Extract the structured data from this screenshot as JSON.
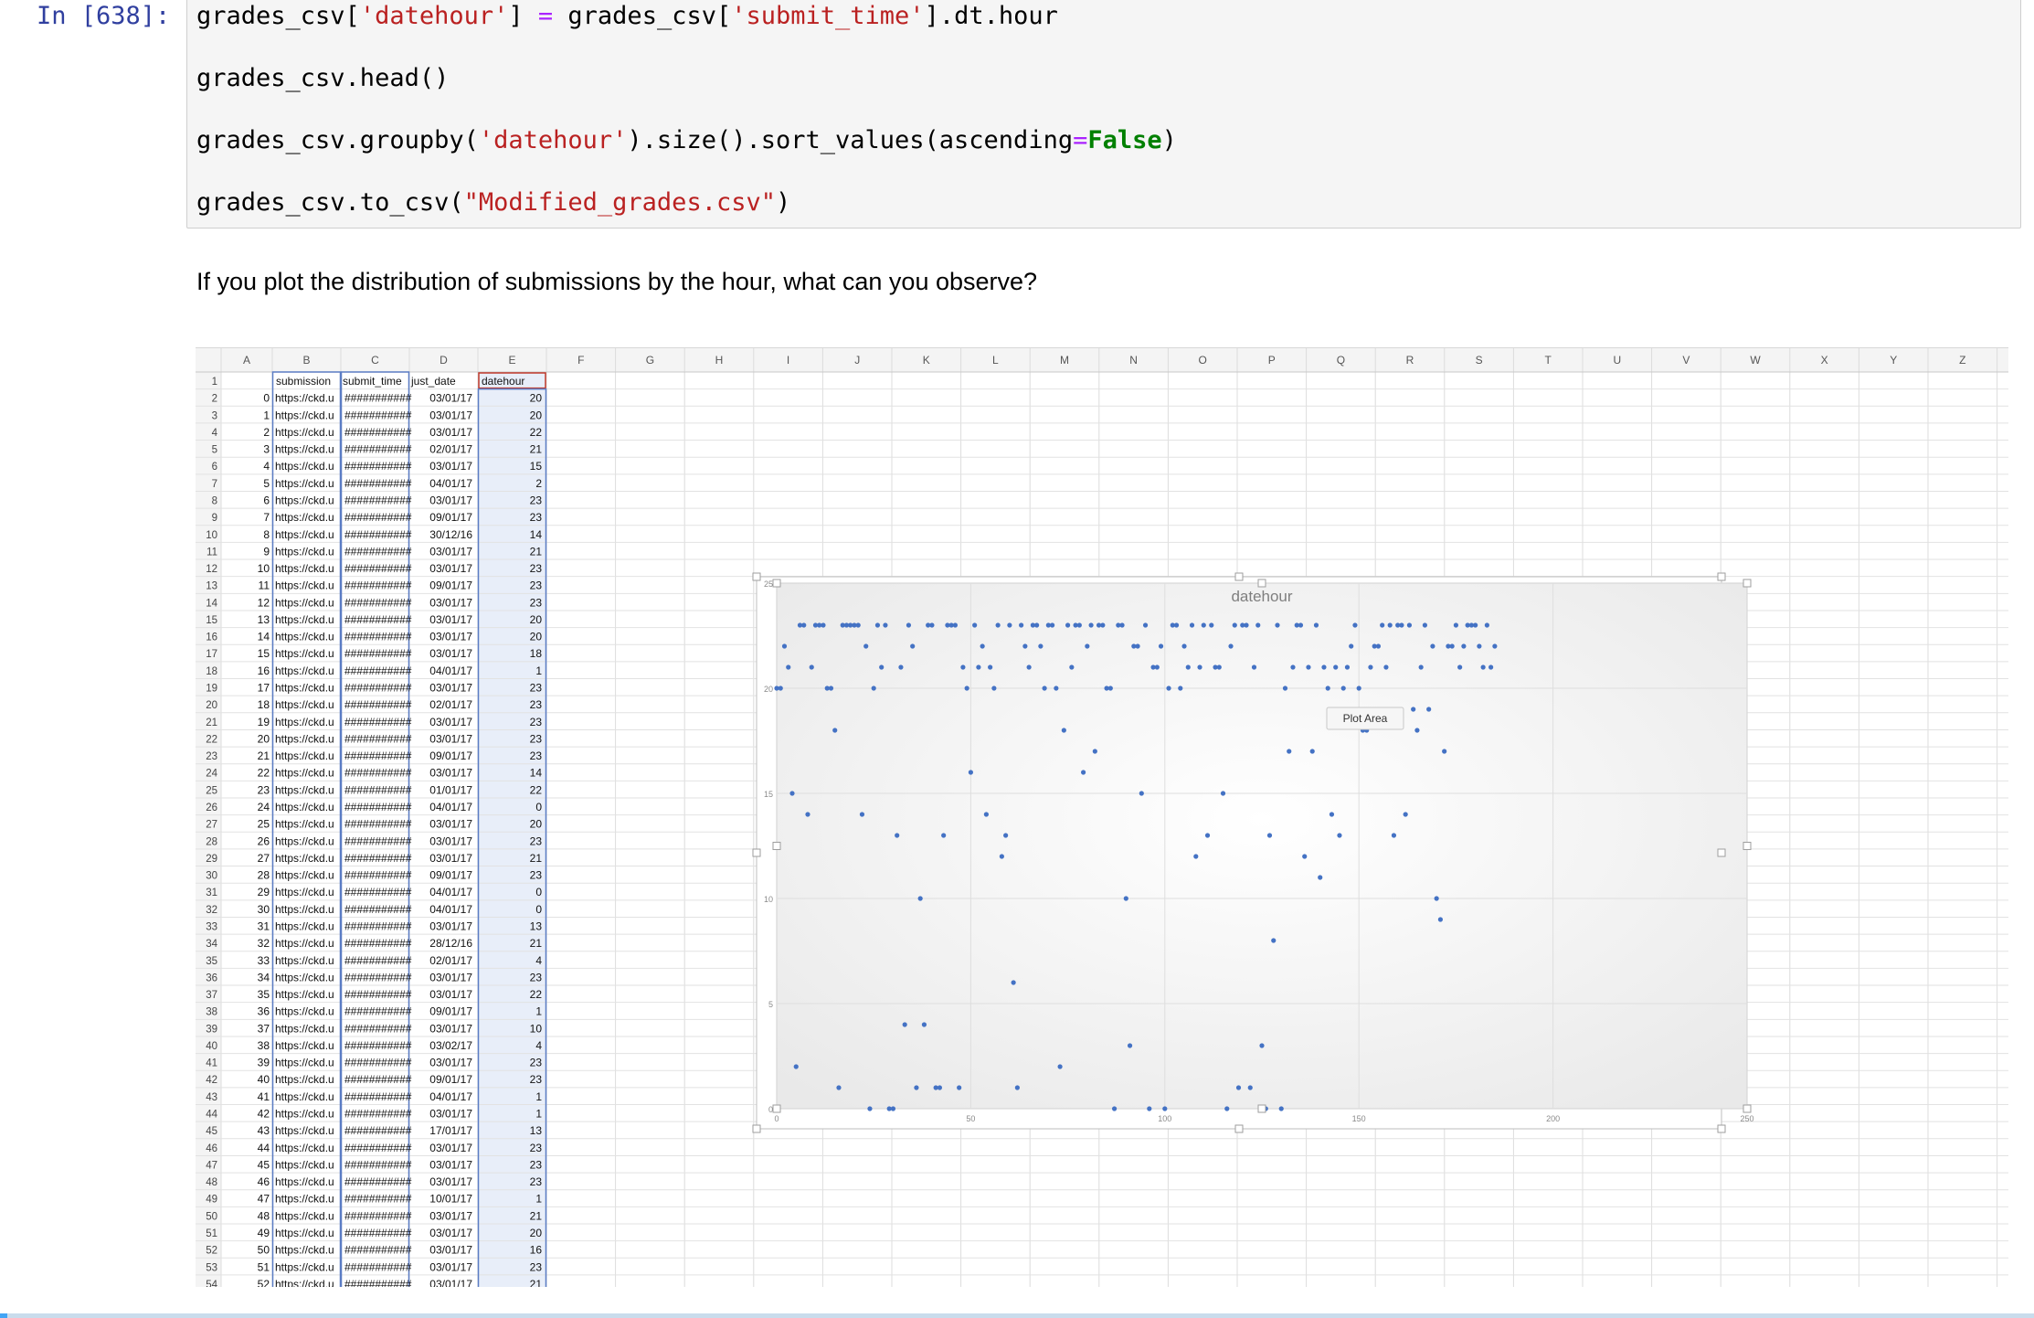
{
  "cell": {
    "prompt": "In [638]:",
    "lines": [
      [
        {
          "t": "grades_csv["
        },
        {
          "t": "'datehour'",
          "c": "tok-str"
        },
        {
          "t": "] "
        },
        {
          "t": "=",
          "c": "tok-op"
        },
        {
          "t": " grades_csv["
        },
        {
          "t": "'submit_time'",
          "c": "tok-str"
        },
        {
          "t": "].dt.hour"
        }
      ],
      [
        {
          "t": "grades_csv.head()"
        }
      ],
      [
        {
          "t": "grades_csv.groupby("
        },
        {
          "t": "'datehour'",
          "c": "tok-str"
        },
        {
          "t": ").size().sort_values(ascending"
        },
        {
          "t": "=",
          "c": "tok-op"
        },
        {
          "t": "False",
          "c": "tok-kw"
        },
        {
          "t": ")"
        }
      ],
      [
        {
          "t": "grades_csv.to_csv("
        },
        {
          "t": "\"Modified_grades.csv\"",
          "c": "tok-str"
        },
        {
          "t": ")"
        }
      ]
    ]
  },
  "markdown": {
    "question": "If you plot the distribution of submissions by the hour, what can you observe?"
  },
  "spreadsheet": {
    "column_letters": [
      "A",
      "B",
      "C",
      "D",
      "E",
      "F",
      "G",
      "H",
      "I",
      "J",
      "K",
      "L",
      "M",
      "N",
      "O",
      "P",
      "Q",
      "R",
      "S",
      "T",
      "U",
      "V",
      "W",
      "X",
      "Y",
      "Z"
    ],
    "headers": {
      "B": "submission",
      "C": "submit_time",
      "D": "just_date",
      "E": "datehour"
    },
    "url_text": "https://ckd.u",
    "time_text": "###########",
    "rows": [
      {
        "n": 0,
        "date": "03/01/17",
        "hour": 20
      },
      {
        "n": 1,
        "date": "03/01/17",
        "hour": 20
      },
      {
        "n": 2,
        "date": "03/01/17",
        "hour": 22
      },
      {
        "n": 3,
        "date": "02/01/17",
        "hour": 21
      },
      {
        "n": 4,
        "date": "03/01/17",
        "hour": 15
      },
      {
        "n": 5,
        "date": "04/01/17",
        "hour": 2
      },
      {
        "n": 6,
        "date": "03/01/17",
        "hour": 23
      },
      {
        "n": 7,
        "date": "09/01/17",
        "hour": 23
      },
      {
        "n": 8,
        "date": "30/12/16",
        "hour": 14
      },
      {
        "n": 9,
        "date": "03/01/17",
        "hour": 21
      },
      {
        "n": 10,
        "date": "03/01/17",
        "hour": 23
      },
      {
        "n": 11,
        "date": "09/01/17",
        "hour": 23
      },
      {
        "n": 12,
        "date": "03/01/17",
        "hour": 23
      },
      {
        "n": 13,
        "date": "03/01/17",
        "hour": 20
      },
      {
        "n": 14,
        "date": "03/01/17",
        "hour": 20
      },
      {
        "n": 15,
        "date": "03/01/17",
        "hour": 18
      },
      {
        "n": 16,
        "date": "04/01/17",
        "hour": 1
      },
      {
        "n": 17,
        "date": "03/01/17",
        "hour": 23
      },
      {
        "n": 18,
        "date": "02/01/17",
        "hour": 23
      },
      {
        "n": 19,
        "date": "03/01/17",
        "hour": 23
      },
      {
        "n": 20,
        "date": "03/01/17",
        "hour": 23
      },
      {
        "n": 21,
        "date": "09/01/17",
        "hour": 23
      },
      {
        "n": 22,
        "date": "03/01/17",
        "hour": 14
      },
      {
        "n": 23,
        "date": "01/01/17",
        "hour": 22
      },
      {
        "n": 24,
        "date": "04/01/17",
        "hour": 0
      },
      {
        "n": 25,
        "date": "03/01/17",
        "hour": 20
      },
      {
        "n": 26,
        "date": "03/01/17",
        "hour": 23
      },
      {
        "n": 27,
        "date": "03/01/17",
        "hour": 21
      },
      {
        "n": 28,
        "date": "09/01/17",
        "hour": 23
      },
      {
        "n": 29,
        "date": "04/01/17",
        "hour": 0
      },
      {
        "n": 30,
        "date": "04/01/17",
        "hour": 0
      },
      {
        "n": 31,
        "date": "03/01/17",
        "hour": 13
      },
      {
        "n": 32,
        "date": "28/12/16",
        "hour": 21
      },
      {
        "n": 33,
        "date": "02/01/17",
        "hour": 4
      },
      {
        "n": 34,
        "date": "03/01/17",
        "hour": 23
      },
      {
        "n": 35,
        "date": "03/01/17",
        "hour": 22
      },
      {
        "n": 36,
        "date": "09/01/17",
        "hour": 1
      },
      {
        "n": 37,
        "date": "03/01/17",
        "hour": 10
      },
      {
        "n": 38,
        "date": "03/02/17",
        "hour": 4
      },
      {
        "n": 39,
        "date": "03/01/17",
        "hour": 23
      },
      {
        "n": 40,
        "date": "09/01/17",
        "hour": 23
      },
      {
        "n": 41,
        "date": "04/01/17",
        "hour": 1
      },
      {
        "n": 42,
        "date": "03/01/17",
        "hour": 1
      },
      {
        "n": 43,
        "date": "17/01/17",
        "hour": 13
      },
      {
        "n": 44,
        "date": "03/01/17",
        "hour": 23
      },
      {
        "n": 45,
        "date": "03/01/17",
        "hour": 23
      },
      {
        "n": 46,
        "date": "03/01/17",
        "hour": 23
      },
      {
        "n": 47,
        "date": "10/01/17",
        "hour": 1
      },
      {
        "n": 48,
        "date": "03/01/17",
        "hour": 21
      },
      {
        "n": 49,
        "date": "03/01/17",
        "hour": 20
      },
      {
        "n": 50,
        "date": "03/01/17",
        "hour": 16
      },
      {
        "n": 51,
        "date": "03/01/17",
        "hour": 23
      },
      {
        "n": 52,
        "date": "03/01/17",
        "hour": 21
      }
    ]
  },
  "chart_data": {
    "type": "scatter",
    "title": "datehour",
    "tooltip": "Plot Area",
    "xlim": [
      0,
      250
    ],
    "ylim": [
      0,
      25
    ],
    "xticks": [
      0,
      50,
      100,
      150,
      200,
      250
    ],
    "yticks": [
      0,
      5,
      10,
      15,
      20,
      25
    ],
    "grid": true,
    "series_color": "#4472c4",
    "points": [
      [
        0,
        20
      ],
      [
        1,
        20
      ],
      [
        2,
        22
      ],
      [
        3,
        21
      ],
      [
        4,
        15
      ],
      [
        5,
        2
      ],
      [
        6,
        23
      ],
      [
        7,
        23
      ],
      [
        8,
        14
      ],
      [
        9,
        21
      ],
      [
        10,
        23
      ],
      [
        11,
        23
      ],
      [
        12,
        23
      ],
      [
        13,
        20
      ],
      [
        14,
        20
      ],
      [
        15,
        18
      ],
      [
        16,
        1
      ],
      [
        17,
        23
      ],
      [
        18,
        23
      ],
      [
        19,
        23
      ],
      [
        20,
        23
      ],
      [
        21,
        23
      ],
      [
        22,
        14
      ],
      [
        23,
        22
      ],
      [
        24,
        0
      ],
      [
        25,
        20
      ],
      [
        26,
        23
      ],
      [
        27,
        21
      ],
      [
        28,
        23
      ],
      [
        29,
        0
      ],
      [
        30,
        0
      ],
      [
        31,
        13
      ],
      [
        32,
        21
      ],
      [
        33,
        4
      ],
      [
        34,
        23
      ],
      [
        35,
        22
      ],
      [
        36,
        1
      ],
      [
        37,
        10
      ],
      [
        38,
        4
      ],
      [
        39,
        23
      ],
      [
        40,
        23
      ],
      [
        41,
        1
      ],
      [
        42,
        1
      ],
      [
        43,
        13
      ],
      [
        44,
        23
      ],
      [
        45,
        23
      ],
      [
        46,
        23
      ],
      [
        47,
        1
      ],
      [
        48,
        21
      ],
      [
        49,
        20
      ],
      [
        50,
        16
      ],
      [
        51,
        23
      ],
      [
        52,
        21
      ],
      [
        53,
        22
      ],
      [
        54,
        14
      ],
      [
        55,
        21
      ],
      [
        56,
        20
      ],
      [
        57,
        23
      ],
      [
        58,
        12
      ],
      [
        59,
        13
      ],
      [
        60,
        23
      ],
      [
        61,
        6
      ],
      [
        62,
        1
      ],
      [
        63,
        23
      ],
      [
        64,
        22
      ],
      [
        65,
        21
      ],
      [
        66,
        23
      ],
      [
        67,
        23
      ],
      [
        68,
        22
      ],
      [
        69,
        20
      ],
      [
        70,
        23
      ],
      [
        71,
        23
      ],
      [
        72,
        20
      ],
      [
        73,
        2
      ],
      [
        74,
        18
      ],
      [
        75,
        23
      ],
      [
        76,
        21
      ],
      [
        77,
        23
      ],
      [
        78,
        23
      ],
      [
        79,
        16
      ],
      [
        80,
        22
      ],
      [
        81,
        23
      ],
      [
        82,
        17
      ],
      [
        83,
        23
      ],
      [
        84,
        23
      ],
      [
        85,
        20
      ],
      [
        86,
        20
      ],
      [
        87,
        0
      ],
      [
        88,
        23
      ],
      [
        89,
        23
      ],
      [
        90,
        10
      ],
      [
        91,
        3
      ],
      [
        92,
        22
      ],
      [
        93,
        22
      ],
      [
        94,
        15
      ],
      [
        95,
        23
      ],
      [
        96,
        0
      ],
      [
        97,
        21
      ],
      [
        98,
        21
      ],
      [
        99,
        22
      ],
      [
        100,
        0
      ],
      [
        101,
        20
      ],
      [
        102,
        23
      ],
      [
        103,
        23
      ],
      [
        104,
        20
      ],
      [
        105,
        22
      ],
      [
        106,
        21
      ],
      [
        107,
        23
      ],
      [
        108,
        12
      ],
      [
        109,
        21
      ],
      [
        110,
        23
      ],
      [
        111,
        13
      ],
      [
        112,
        23
      ],
      [
        113,
        21
      ],
      [
        114,
        21
      ],
      [
        115,
        15
      ],
      [
        116,
        0
      ],
      [
        117,
        22
      ],
      [
        118,
        23
      ],
      [
        119,
        1
      ],
      [
        120,
        23
      ],
      [
        121,
        23
      ],
      [
        122,
        1
      ],
      [
        123,
        21
      ],
      [
        124,
        23
      ],
      [
        125,
        3
      ],
      [
        126,
        0
      ],
      [
        127,
        13
      ],
      [
        128,
        8
      ],
      [
        129,
        23
      ],
      [
        130,
        0
      ],
      [
        131,
        20
      ],
      [
        132,
        17
      ],
      [
        133,
        21
      ],
      [
        134,
        23
      ],
      [
        135,
        23
      ],
      [
        136,
        12
      ],
      [
        137,
        21
      ],
      [
        138,
        17
      ],
      [
        139,
        23
      ],
      [
        140,
        11
      ],
      [
        141,
        21
      ],
      [
        142,
        20
      ],
      [
        143,
        14
      ],
      [
        144,
        21
      ],
      [
        145,
        13
      ],
      [
        146,
        20
      ],
      [
        147,
        21
      ],
      [
        148,
        22
      ],
      [
        149,
        23
      ],
      [
        150,
        20
      ],
      [
        151,
        18
      ],
      [
        152,
        18
      ],
      [
        153,
        21
      ],
      [
        154,
        22
      ],
      [
        155,
        22
      ],
      [
        156,
        23
      ],
      [
        157,
        21
      ],
      [
        158,
        23
      ],
      [
        159,
        13
      ],
      [
        160,
        23
      ],
      [
        161,
        23
      ],
      [
        162,
        14
      ],
      [
        163,
        23
      ],
      [
        164,
        19
      ],
      [
        165,
        18
      ],
      [
        166,
        21
      ],
      [
        167,
        23
      ],
      [
        168,
        19
      ],
      [
        169,
        22
      ],
      [
        170,
        10
      ],
      [
        171,
        9
      ],
      [
        172,
        17
      ],
      [
        173,
        22
      ],
      [
        174,
        22
      ],
      [
        175,
        23
      ],
      [
        176,
        21
      ],
      [
        177,
        22
      ],
      [
        178,
        23
      ],
      [
        179,
        23
      ],
      [
        180,
        23
      ],
      [
        181,
        22
      ],
      [
        182,
        21
      ],
      [
        183,
        23
      ],
      [
        184,
        21
      ],
      [
        185,
        22
      ]
    ]
  }
}
